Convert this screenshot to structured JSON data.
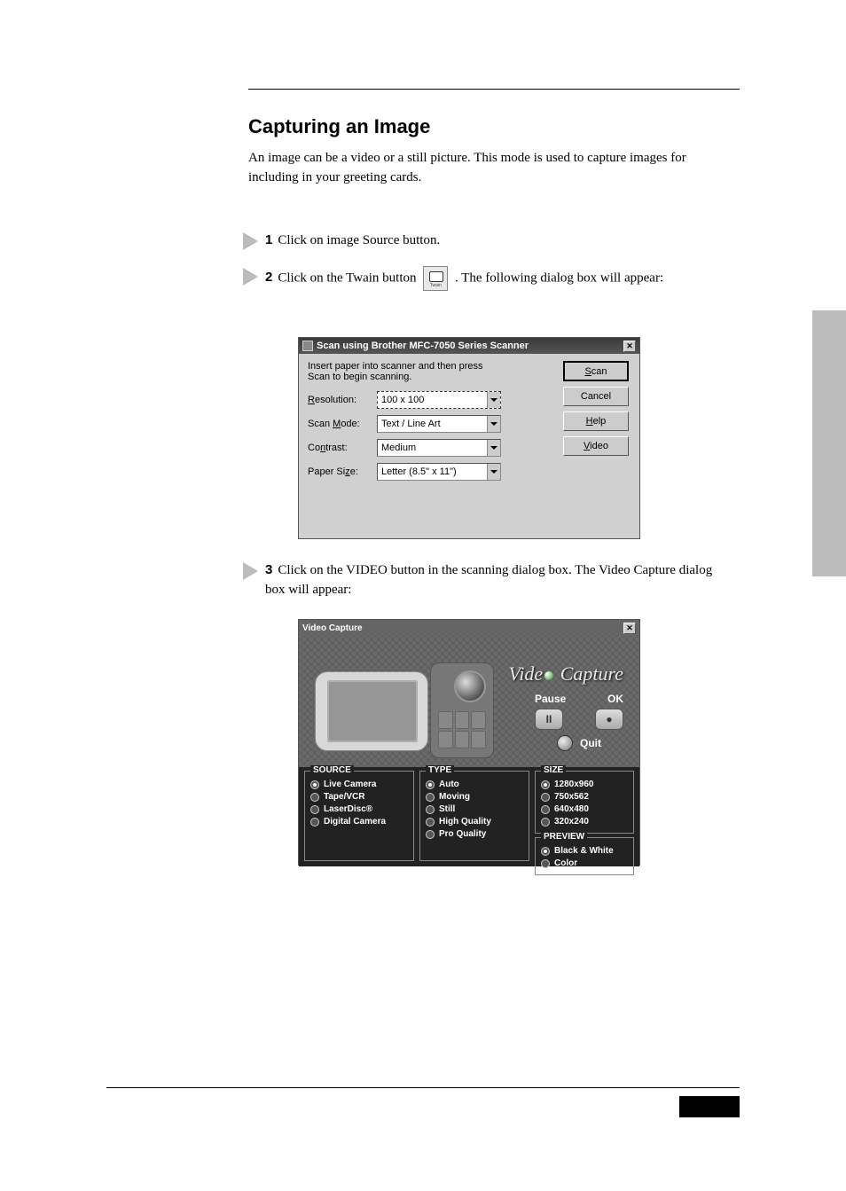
{
  "page": {
    "heading": "Capturing an Image",
    "intro": "An image can be a video or a still picture. This mode is used to capture images for including in your greeting cards.",
    "step1": "Click on image Source button.",
    "step2_a": "Click on the Twain button  ",
    "step2_b": " . The following dialog box will appear:",
    "step3": "Click on the VIDEO button in the scanning dialog box. The Video Capture dialog box will appear:"
  },
  "scan_dialog": {
    "title": "Scan using Brother MFC-7050 Series Scanner",
    "instruction": "Insert paper into scanner and then press Scan to begin scanning.",
    "labels": {
      "resolution": "Resolution:",
      "scanmode": "Scan Mode:",
      "contrast": "Contrast:",
      "papersize": "Paper Size:"
    },
    "values": {
      "resolution": "100 x 100",
      "scanmode": "Text / Line Art",
      "contrast": "Medium",
      "papersize": "Letter (8.5\" x 11\")"
    },
    "buttons": {
      "scan": "Scan",
      "cancel": "Cancel",
      "help": "Help",
      "video": "Video"
    }
  },
  "video_dialog": {
    "title": "Video Capture",
    "heading_a": "Vide",
    "heading_b": " Capture",
    "btns": {
      "pause": "Pause",
      "ok": "OK",
      "pause_glyph": "II",
      "ok_glyph": "●",
      "quit": "Quit"
    },
    "source": {
      "legend": "SOURCE",
      "opts": [
        "Live Camera",
        "Tape/VCR",
        "LaserDisc®",
        "Digital Camera"
      ]
    },
    "type": {
      "legend": "TYPE",
      "opts": [
        "Auto",
        "Moving",
        "Still",
        "High Quality",
        "Pro Quality"
      ]
    },
    "size": {
      "legend": "SIZE",
      "opts": [
        "1280x960",
        "750x562",
        "640x480",
        "320x240"
      ]
    },
    "preview": {
      "legend": "PREVIEW",
      "opts": [
        "Black & White",
        "Color"
      ]
    }
  }
}
